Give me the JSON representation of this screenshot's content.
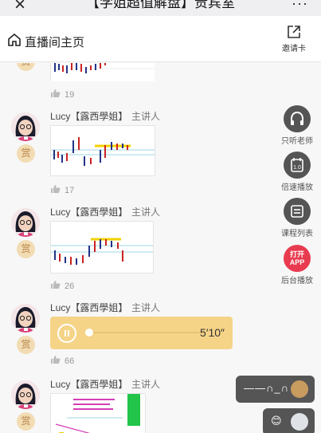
{
  "topbar": {
    "close": "×",
    "title": "【学姐超值解盘】贵宾室",
    "more": "···"
  },
  "livebar": {
    "home_label": "直播间主页",
    "invite_label": "邀请卡"
  },
  "reward_label": "赏",
  "messages": [
    {
      "likes": "19"
    },
    {
      "sender": "Lucy【露西學姐】",
      "role": "主讲人",
      "likes": "17"
    },
    {
      "sender": "Lucy【露西學姐】",
      "role": "主讲人",
      "likes": "26"
    },
    {
      "sender": "Lucy【露西學姐】",
      "role": "主讲人",
      "likes": "66",
      "voice_duration": "5′10″"
    },
    {
      "sender": "Lucy【露西學姐】",
      "role": "主讲人"
    }
  ],
  "side_buttons": [
    {
      "label": "只听老师",
      "icon": "headphones-icon"
    },
    {
      "label": "倍速播放",
      "icon": "speed-icon",
      "value": "1.0"
    },
    {
      "label": "课程列表",
      "icon": "list-icon"
    },
    {
      "label": "后台播放",
      "icon": "open-app-icon",
      "text": "打开APP"
    }
  ],
  "danmu": [
    {
      "text": "——∩_∩"
    },
    {
      "text": "😊"
    }
  ],
  "colors": {
    "accent_red": "#e83b4f",
    "voice_bg": "#f5d488",
    "reward_bg": "#f2dcb3"
  }
}
